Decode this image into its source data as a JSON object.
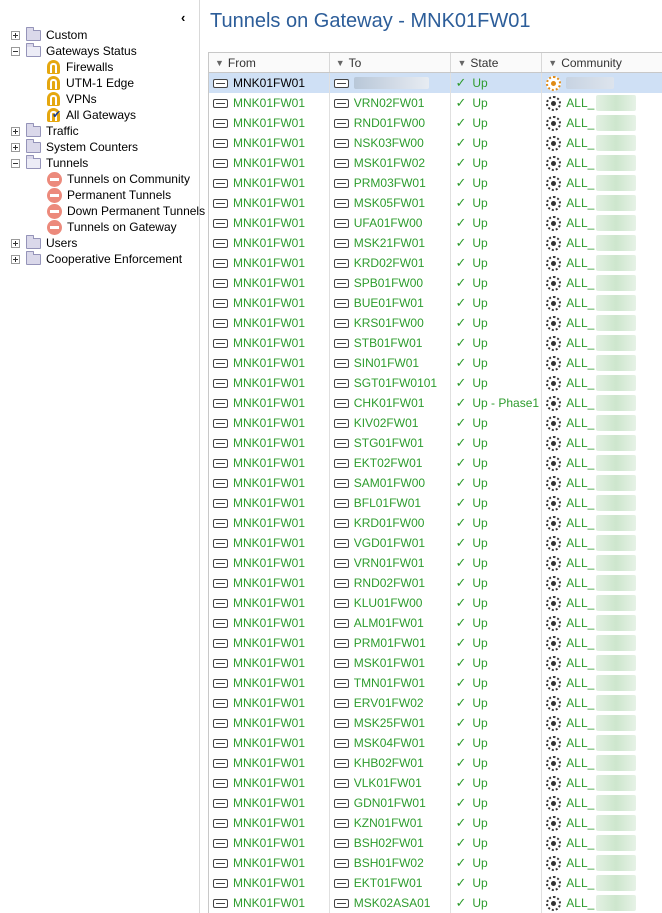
{
  "tree": {
    "collapse_glyph": "‹",
    "nodes": [
      {
        "label": "Custom",
        "level": 0,
        "expander": "plus",
        "icon": "folder-icon"
      },
      {
        "label": "Gateways Status",
        "level": 0,
        "expander": "minus",
        "icon": "open-folder-icon"
      },
      {
        "label": "Firewalls",
        "level": 1,
        "expander": "",
        "icon": "gateway-icon"
      },
      {
        "label": "UTM-1 Edge",
        "level": 1,
        "expander": "",
        "icon": "gateway-icon"
      },
      {
        "label": "VPNs",
        "level": 1,
        "expander": "",
        "icon": "gateway-icon"
      },
      {
        "label": "All Gateways",
        "level": 1,
        "expander": "",
        "icon": "gateway-check-icon"
      },
      {
        "label": "Traffic",
        "level": 0,
        "expander": "plus",
        "icon": "folder-icon"
      },
      {
        "label": "System Counters",
        "level": 0,
        "expander": "plus",
        "icon": "folder-icon"
      },
      {
        "label": "Tunnels",
        "level": 0,
        "expander": "minus",
        "icon": "open-folder-icon"
      },
      {
        "label": "Tunnels on Community",
        "level": 1,
        "expander": "",
        "icon": "tunnel-icon"
      },
      {
        "label": "Permanent Tunnels",
        "level": 1,
        "expander": "",
        "icon": "tunnel-icon"
      },
      {
        "label": "Down Permanent Tunnels",
        "level": 1,
        "expander": "",
        "icon": "tunnel-icon"
      },
      {
        "label": "Tunnels on Gateway",
        "level": 1,
        "expander": "",
        "icon": "tunnel-icon"
      },
      {
        "label": "Users",
        "level": 0,
        "expander": "plus",
        "icon": "folder-icon"
      },
      {
        "label": "Cooperative Enforcement",
        "level": 0,
        "expander": "plus",
        "icon": "folder-icon"
      }
    ]
  },
  "page": {
    "title": "Tunnels on Gateway - MNK01FW01"
  },
  "grid": {
    "columns": [
      "From",
      "To",
      "State",
      "Community"
    ],
    "rows": [
      {
        "from": "MNK01FW01",
        "to": "",
        "state": "Up",
        "community": "",
        "selected": true
      },
      {
        "from": "MNK01FW01",
        "to": "VRN02FW01",
        "state": "Up",
        "community": "ALL_"
      },
      {
        "from": "MNK01FW01",
        "to": "RND01FW00",
        "state": "Up",
        "community": "ALL_"
      },
      {
        "from": "MNK01FW01",
        "to": "NSK03FW00",
        "state": "Up",
        "community": "ALL_"
      },
      {
        "from": "MNK01FW01",
        "to": "MSK01FW02",
        "state": "Up",
        "community": "ALL_"
      },
      {
        "from": "MNK01FW01",
        "to": "PRM03FW01",
        "state": "Up",
        "community": "ALL_"
      },
      {
        "from": "MNK01FW01",
        "to": "MSK05FW01",
        "state": "Up",
        "community": "ALL_"
      },
      {
        "from": "MNK01FW01",
        "to": "UFA01FW00",
        "state": "Up",
        "community": "ALL_"
      },
      {
        "from": "MNK01FW01",
        "to": "MSK21FW01",
        "state": "Up",
        "community": "ALL_"
      },
      {
        "from": "MNK01FW01",
        "to": "KRD02FW01",
        "state": "Up",
        "community": "ALL_"
      },
      {
        "from": "MNK01FW01",
        "to": "SPB01FW00",
        "state": "Up",
        "community": "ALL_"
      },
      {
        "from": "MNK01FW01",
        "to": "BUE01FW01",
        "state": "Up",
        "community": "ALL_"
      },
      {
        "from": "MNK01FW01",
        "to": "KRS01FW00",
        "state": "Up",
        "community": "ALL_"
      },
      {
        "from": "MNK01FW01",
        "to": "STB01FW01",
        "state": "Up",
        "community": "ALL_"
      },
      {
        "from": "MNK01FW01",
        "to": "SIN01FW01",
        "state": "Up",
        "community": "ALL_"
      },
      {
        "from": "MNK01FW01",
        "to": "SGT01FW0101",
        "state": "Up",
        "community": "ALL_"
      },
      {
        "from": "MNK01FW01",
        "to": "CHK01FW01",
        "state": "Up - Phase1",
        "community": "ALL_"
      },
      {
        "from": "MNK01FW01",
        "to": "KIV02FW01",
        "state": "Up",
        "community": "ALL_"
      },
      {
        "from": "MNK01FW01",
        "to": "STG01FW01",
        "state": "Up",
        "community": "ALL_"
      },
      {
        "from": "MNK01FW01",
        "to": "EKT02FW01",
        "state": "Up",
        "community": "ALL_"
      },
      {
        "from": "MNK01FW01",
        "to": "SAM01FW00",
        "state": "Up",
        "community": "ALL_"
      },
      {
        "from": "MNK01FW01",
        "to": "BFL01FW01",
        "state": "Up",
        "community": "ALL_"
      },
      {
        "from": "MNK01FW01",
        "to": "KRD01FW00",
        "state": "Up",
        "community": "ALL_"
      },
      {
        "from": "MNK01FW01",
        "to": "VGD01FW01",
        "state": "Up",
        "community": "ALL_"
      },
      {
        "from": "MNK01FW01",
        "to": "VRN01FW01",
        "state": "Up",
        "community": "ALL_"
      },
      {
        "from": "MNK01FW01",
        "to": "RND02FW01",
        "state": "Up",
        "community": "ALL_"
      },
      {
        "from": "MNK01FW01",
        "to": "KLU01FW00",
        "state": "Up",
        "community": "ALL_"
      },
      {
        "from": "MNK01FW01",
        "to": "ALM01FW01",
        "state": "Up",
        "community": "ALL_"
      },
      {
        "from": "MNK01FW01",
        "to": "PRM01FW01",
        "state": "Up",
        "community": "ALL_"
      },
      {
        "from": "MNK01FW01",
        "to": "MSK01FW01",
        "state": "Up",
        "community": "ALL_"
      },
      {
        "from": "MNK01FW01",
        "to": "TMN01FW01",
        "state": "Up",
        "community": "ALL_"
      },
      {
        "from": "MNK01FW01",
        "to": "ERV01FW02",
        "state": "Up",
        "community": "ALL_"
      },
      {
        "from": "MNK01FW01",
        "to": "MSK25FW01",
        "state": "Up",
        "community": "ALL_"
      },
      {
        "from": "MNK01FW01",
        "to": "MSK04FW01",
        "state": "Up",
        "community": "ALL_"
      },
      {
        "from": "MNK01FW01",
        "to": "KHB02FW01",
        "state": "Up",
        "community": "ALL_"
      },
      {
        "from": "MNK01FW01",
        "to": "VLK01FW01",
        "state": "Up",
        "community": "ALL_"
      },
      {
        "from": "MNK01FW01",
        "to": "GDN01FW01",
        "state": "Up",
        "community": "ALL_"
      },
      {
        "from": "MNK01FW01",
        "to": "KZN01FW01",
        "state": "Up",
        "community": "ALL_"
      },
      {
        "from": "MNK01FW01",
        "to": "BSH02FW01",
        "state": "Up",
        "community": "ALL_"
      },
      {
        "from": "MNK01FW01",
        "to": "BSH01FW02",
        "state": "Up",
        "community": "ALL_"
      },
      {
        "from": "MNK01FW01",
        "to": "EKT01FW01",
        "state": "Up",
        "community": "ALL_"
      },
      {
        "from": "MNK01FW01",
        "to": "MSK02ASA01",
        "state": "Up",
        "community": "ALL_"
      }
    ]
  },
  "colors": {
    "title_blue": "#2c5d99",
    "status_green": "#2e9c2e",
    "selected_row": "#cfe0f5"
  }
}
